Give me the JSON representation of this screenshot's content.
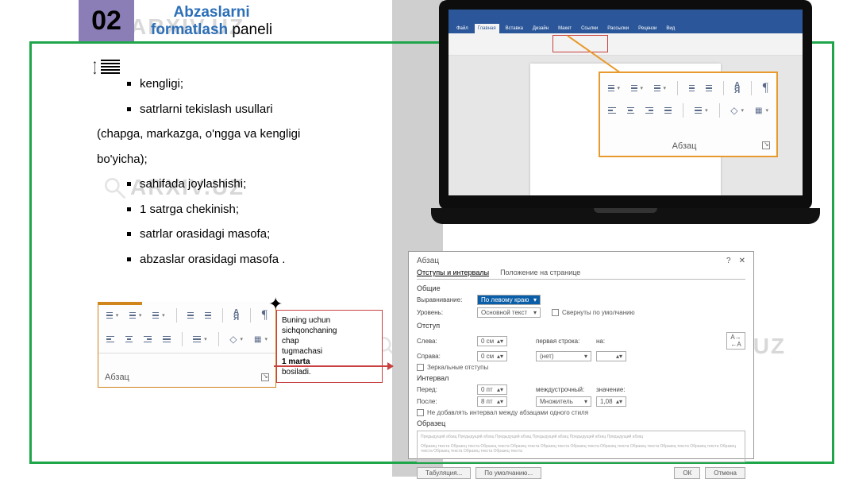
{
  "page_num": "02",
  "title": {
    "line1": "Abzaslarni",
    "line2_blue": "formatlash",
    "line2_black": " paneli"
  },
  "watermark_text": "ARXIV.UZ",
  "bullets": [
    {
      "text": "kengligi;",
      "type": "bullet"
    },
    {
      "text": "satrlarni tekislash usullari",
      "type": "bullet"
    },
    {
      "text": "(chapga, markazga, o'ngga va kengligi",
      "type": "nobullet"
    },
    {
      "text": "bo'yicha);",
      "type": "nobullet"
    },
    {
      "text": "sahifada joylashishi;",
      "type": "bullet"
    },
    {
      "text": "1 satrga chekinish;",
      "type": "bullet"
    },
    {
      "text": "satrlar orasidagi masofa;",
      "type": "bullet"
    },
    {
      "text": "abzaslar orasidagi masofa .",
      "type": "bullet"
    }
  ],
  "panel": {
    "group_label": "Абзац"
  },
  "note": {
    "l1": "Buning uchun",
    "l2": "sichqonchaning",
    "l3": "chap",
    "l4": "tugmachasi",
    "l5_bold": "1 marta",
    "l6": "bosiladi."
  },
  "word": {
    "tabs": [
      "Файл",
      "Главная",
      "Вставка",
      "Дизайн",
      "Макет",
      "Ссылки",
      "Рассылки",
      "Рецензи",
      "Вид"
    ]
  },
  "dialog": {
    "window_title": "Абзац",
    "tabs": [
      "Отступы и интервалы",
      "Положение на странице"
    ],
    "sections": {
      "general": "Общие",
      "indent": "Отступ",
      "spacing": "Интервал",
      "preview": "Образец"
    },
    "labels": {
      "alignment": "Выравнивание:",
      "level": "Уровень:",
      "left": "Слева:",
      "right": "Справа:",
      "first_line": "первая строка:",
      "first_on": "на:",
      "before": "Перед:",
      "after": "После:",
      "line_spacing": "междустрочный:",
      "spacing_value": "значение:"
    },
    "values": {
      "alignment": "По левому краю",
      "level": "Основной текст",
      "collapsed": "Свернуты по умолчанию",
      "left": "0 см",
      "right": "0 см",
      "first_line": "(нет)",
      "mirror": "Зеркальные отступы",
      "before": "0 пт",
      "after": "8 пт",
      "line_spacing": "Множитель",
      "spacing_value": "1,08",
      "no_add": "Не добавлять интервал между абзацами одного стиля"
    },
    "buttons": {
      "tabs_btn": "Табуляция...",
      "default_btn": "По умолчанию...",
      "ok": "ОК",
      "cancel": "Отмена"
    }
  }
}
